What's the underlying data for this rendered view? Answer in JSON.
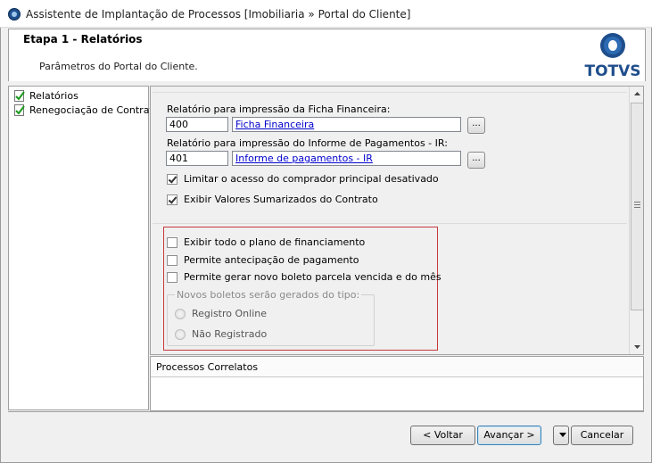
{
  "window": {
    "title": "Assistente de Implantação de Processos [Imobiliaria » Portal do Cliente]"
  },
  "header": {
    "step_title": "Etapa 1 - Relatórios",
    "step_description": "Parâmetros do Portal do Cliente.",
    "logo_text": "TOTVS"
  },
  "nav": {
    "items": [
      {
        "label": "Relatórios",
        "icon": "checked-document-icon"
      },
      {
        "label": "Renegociação de Contrato",
        "icon": "checked-document-icon"
      }
    ]
  },
  "form": {
    "ficha": {
      "label": "Relatório para impressão da Ficha Financeira:",
      "code": "400",
      "report": "Ficha Financeira",
      "button": "..."
    },
    "informe": {
      "label": "Relatório para impressão do Informe de Pagamentos - IR:",
      "code": "401",
      "report": "Informe de pagamentos - IR",
      "button": "..."
    },
    "checkboxes_top": [
      {
        "label": "Limitar o acesso do comprador principal desativado",
        "checked": true
      },
      {
        "label": "Exibir Valores Sumarizados do Contrato",
        "checked": true
      }
    ],
    "checkboxes_bottom": [
      {
        "label": "Exibir todo o plano de financiamento",
        "checked": false
      },
      {
        "label": "Permite antecipação de pagamento",
        "checked": false
      },
      {
        "label": "Permite gerar novo boleto parcela vencida e do mês",
        "checked": false
      }
    ],
    "boletos_group": {
      "legend": "Novos boletos serão gerados do tipo:",
      "options": [
        {
          "label": "Registro Online",
          "selected": false
        },
        {
          "label": "Não Registrado",
          "selected": false
        }
      ]
    }
  },
  "related": {
    "title": "Processos Correlatos"
  },
  "footer": {
    "back": "< Voltar",
    "next": "Avançar >",
    "cancel": "Cancelar"
  },
  "colors": {
    "highlight_box": "#c8393c",
    "link": "#0000cc",
    "logo_blue": "#1f4e8c"
  }
}
